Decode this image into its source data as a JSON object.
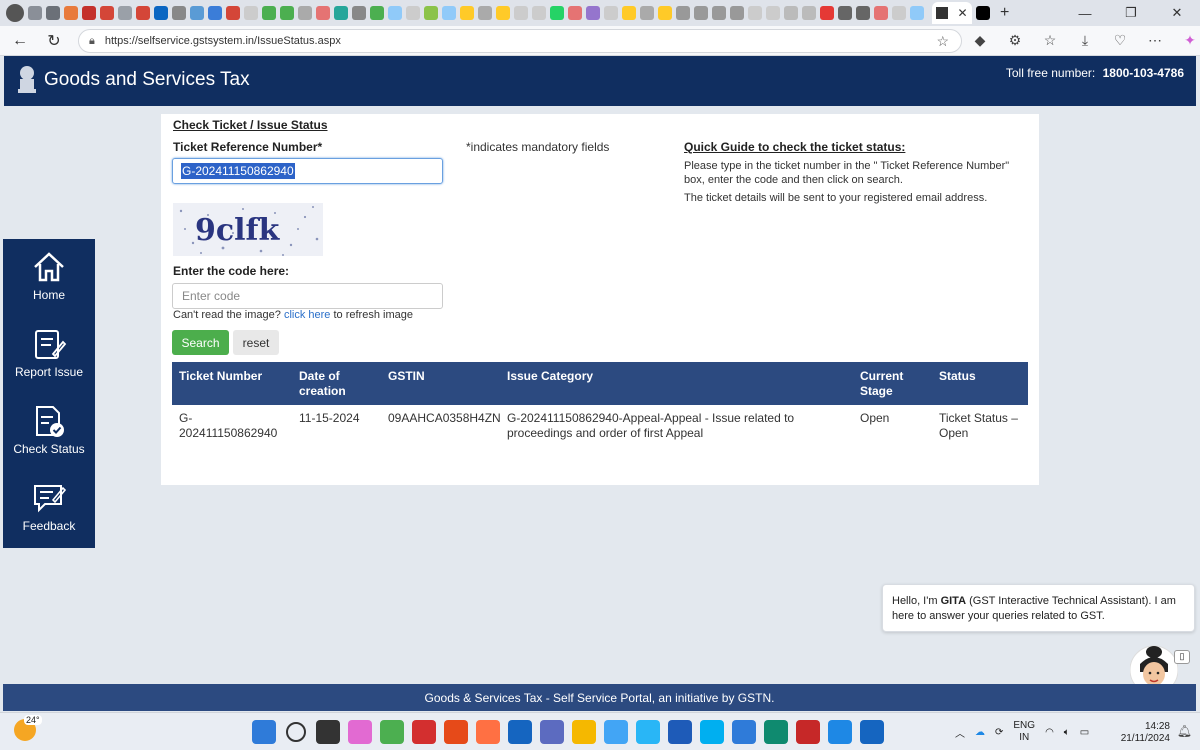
{
  "browser": {
    "url": "https://selfservice.gstsystem.in/IssueStatus.aspx"
  },
  "header": {
    "title": "Goods and Services Tax",
    "tollfree_label": "Toll free number:",
    "tollfree_number": "1800-103-4786"
  },
  "sidebar": {
    "items": [
      {
        "label": "Home"
      },
      {
        "label": "Report Issue"
      },
      {
        "label": "Check Status"
      },
      {
        "label": "Feedback"
      }
    ]
  },
  "form": {
    "page_title": "Check Ticket / Issue Status",
    "ticket_label": "Ticket Reference Number*",
    "ticket_value": "G-202411150862940",
    "mandatory_note": "*indicates mandatory fields",
    "captcha_text": "9clfk",
    "code_label": "Enter the code here:",
    "code_placeholder": "Enter code",
    "refresh_prefix": "Can't read the image?",
    "refresh_link": "click here",
    "refresh_suffix": "to refresh image",
    "search_label": "Search",
    "reset_label": "reset"
  },
  "guide": {
    "title": "Quick Guide to check the ticket status:",
    "p1": "Please type in the ticket number in the \" Ticket Reference Number\" box, enter the code and then click on search.",
    "p2": "The ticket details will be sent to your registered email address."
  },
  "table": {
    "headers": {
      "ticket": "Ticket Number",
      "date_l1": "Date of",
      "date_l2": "creation",
      "gstin": "GSTIN",
      "category": "Issue Category",
      "stage_l1": "Current",
      "stage_l2": "Stage",
      "status": "Status"
    },
    "row": {
      "ticket_l1": "G-",
      "ticket_l2": "202411150862940",
      "date": "11-15-2024",
      "gstin": "09AAHCA0358H4ZN",
      "category_l1": "G-202411150862940-Appeal-Appeal - Issue related to",
      "category_l2": "proceedings and order of first Appeal",
      "stage": "Open",
      "status_l1": "Ticket Status –",
      "status_l2": "Open"
    }
  },
  "footer": {
    "text": "Goods & Services Tax - Self Service Portal, an initiative by GSTN."
  },
  "chat": {
    "greeting": "Hello, I'm",
    "name": "GITA",
    "rest_l1": "(GST Interactive Technical Assistant). I am",
    "rest_l2": "here to answer your queries related to GST."
  },
  "taskbar": {
    "temperature": "24°",
    "lang_l1": "ENG",
    "lang_l2": "IN",
    "time": "14:28",
    "date": "21/11/2024"
  },
  "colors": {
    "header_navy": "#102e60",
    "table_head": "#2c4a80",
    "search_green": "#4cae4c",
    "link_blue": "#2a6fc9"
  }
}
